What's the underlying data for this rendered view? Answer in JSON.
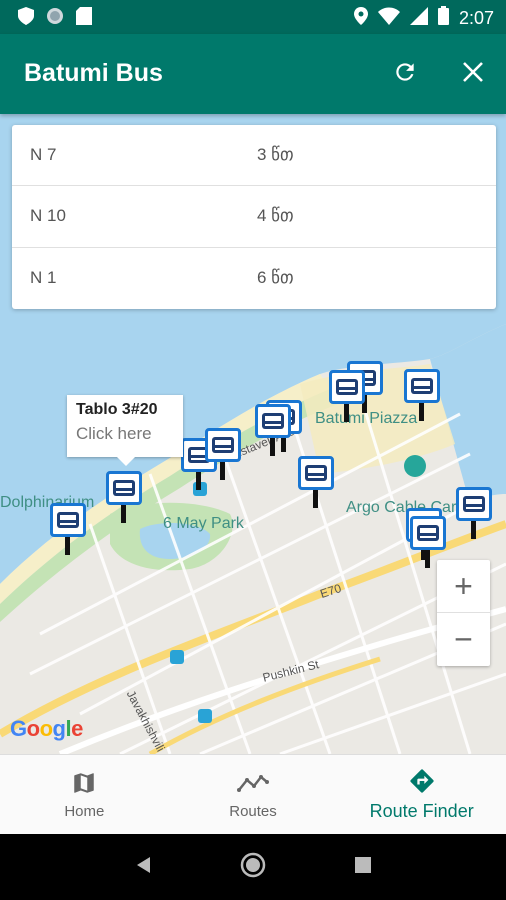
{
  "status_bar": {
    "time": "2:07",
    "left_icons": [
      "shield-icon",
      "circle-icon",
      "sd-card-icon"
    ],
    "right_icons": [
      "location-icon",
      "wifi-icon",
      "signal-icon",
      "battery-icon"
    ]
  },
  "app_bar": {
    "title": "Batumi Bus",
    "actions": [
      "refresh-icon",
      "close-icon"
    ]
  },
  "results": [
    {
      "route": "N 7",
      "time": "3 წთ"
    },
    {
      "route": "N 10",
      "time": "4 წთ"
    },
    {
      "route": "N 1",
      "time": "6 წთ"
    }
  ],
  "map": {
    "info_window": {
      "title": "Tablo 3#20",
      "subtitle": "Click here"
    },
    "labels": {
      "dolphinarium": "Dolphinarium",
      "may_park": "6 May Park",
      "rustaveli": "Rustaveli Ave",
      "batumi_piazza": "Batumi Piazza",
      "argo_cable": "Argo Cable Car",
      "e70": "E70",
      "pushkin": "Pushkin St",
      "javakhishvili": "Javakhishvili"
    },
    "zoom_in": "+",
    "zoom_out": "−",
    "logo": {
      "g1": "G",
      "o1": "o",
      "o2": "o",
      "g2": "g",
      "l": "l",
      "e": "e"
    }
  },
  "bottom_nav": {
    "items": [
      {
        "label": "Home",
        "icon": "map-icon",
        "active": false
      },
      {
        "label": "Routes",
        "icon": "routes-icon",
        "active": false
      },
      {
        "label": "Route Finder",
        "icon": "directions-icon",
        "active": true
      }
    ]
  },
  "colors": {
    "primary": "#00796b",
    "primary_dark": "#00695c",
    "marker_blue": "#1976d2"
  }
}
